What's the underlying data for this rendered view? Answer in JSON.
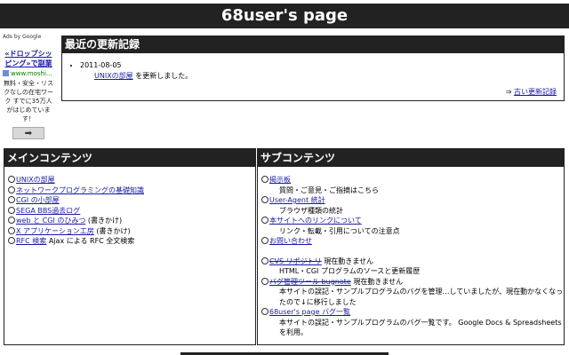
{
  "header": {
    "title": "68user's page"
  },
  "ad": {
    "attribution": "Ads by Google",
    "title": "«ドロップシッピング»で副業",
    "url": "www.moshi...",
    "description": "無料・安全・リスクなしの在宅ワーク すでに35万人がはじめています！",
    "arrow": "➡"
  },
  "updates": {
    "title": "最近の更新記録",
    "entries": [
      {
        "date": "2011-08-05",
        "link": "UNIXの部屋",
        "text": "を更新しました。"
      }
    ],
    "old_arrow": "⇒",
    "old_link": "古い更新記録"
  },
  "main": {
    "title": "メインコンテンツ",
    "items": [
      {
        "link": "UNIXの部屋",
        "suffix": ""
      },
      {
        "link": "ネットワークプログラミングの基礎知識",
        "suffix": ""
      },
      {
        "link": "CGI の小部屋",
        "suffix": ""
      },
      {
        "link": "SEGA BBS過去ログ",
        "suffix": ""
      },
      {
        "link": "web と CGI のひみつ",
        "suffix": "(書きかけ)"
      },
      {
        "link": "X アプリケーション工房",
        "suffix": "(書きかけ)"
      },
      {
        "link": "RFC 検索",
        "suffix": "Ajax による RFC 全文検索"
      }
    ]
  },
  "sub": {
    "title": "サブコンテンツ",
    "items": [
      {
        "link": "掲示板",
        "desc": "質問・ご意見・ご指摘はこちら"
      },
      {
        "link": "User-Agent 統計",
        "desc": "ブラウザ種類の統計"
      },
      {
        "link": "本サイトへのリンクについて",
        "desc": "リンク・転載・引用についての注意点"
      },
      {
        "link": "お問い合わせ",
        "desc": ""
      },
      {
        "link": "CVS リポジトリ",
        "status": "現在動きません",
        "desc": "HTML・CGI プログラムのソースと更新履歴"
      },
      {
        "link": "バグ管理ツール bugnote",
        "status": "現在動きません",
        "desc": "本サイトの誤記・サンプルプログラムのバグを管理…していましたが、現在動かなくなったので↓に移行しました"
      },
      {
        "link": "68user's page バグ一覧",
        "desc": "本サイトの誤記・サンプルプログラムのバグ一覧です。 Google Docs & Spreadsheets を利用。"
      }
    ]
  }
}
